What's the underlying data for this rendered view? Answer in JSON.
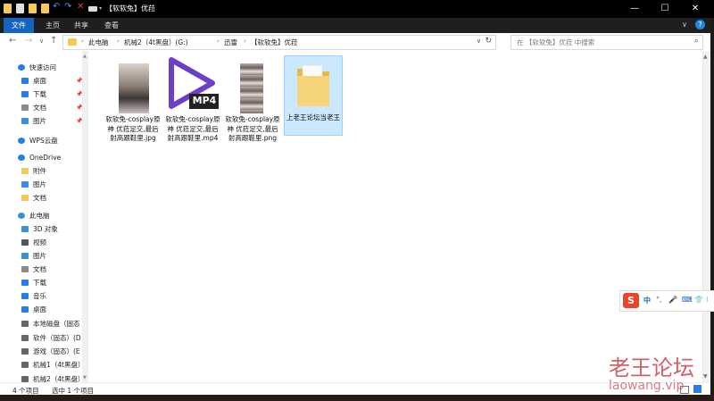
{
  "window": {
    "title": "【软软兔】优菈",
    "minimize_glyph": "—",
    "maximize_glyph": "☐",
    "close_glyph": "✕"
  },
  "ribbon": {
    "tabs": [
      "文件",
      "主页",
      "共享",
      "查看"
    ],
    "collapse_glyph": "∨",
    "help_glyph": "?"
  },
  "navigation": {
    "back": "←",
    "forward": "→",
    "recent": "∨",
    "up": "↑"
  },
  "address": {
    "crumbs": [
      "此电脑",
      "机械2（4t黑盘）(G:)",
      "迅雷",
      "【软软兔】优菈"
    ],
    "separator": "›",
    "dropdown": "∨",
    "refresh": "↻"
  },
  "search": {
    "placeholder": "在 【软软兔】优菈 中搜索",
    "icon": "⌕"
  },
  "sidebar": {
    "items": [
      {
        "label": "快速访问",
        "icon": "star-icon",
        "color": "#2b7ce9",
        "pinned": false
      },
      {
        "label": "桌面",
        "icon": "desktop-icon",
        "color": "#2b7ce9",
        "pinned": true
      },
      {
        "label": "下载",
        "icon": "download-icon",
        "color": "#2b7ce9",
        "pinned": true
      },
      {
        "label": "文档",
        "icon": "documents-icon",
        "color": "#8a8a8a",
        "pinned": true
      },
      {
        "label": "图片",
        "icon": "pictures-icon",
        "color": "#3a8fd9",
        "pinned": true
      },
      {
        "label": "WPS云盘",
        "icon": "cloud-icon",
        "color": "#2b7ce9",
        "pinned": false
      },
      {
        "label": "OneDrive",
        "icon": "onedrive-icon",
        "color": "#2b7ce9",
        "pinned": false
      },
      {
        "label": "附件",
        "icon": "folder-icon",
        "color": "#f3c95a",
        "pinned": false
      },
      {
        "label": "图片",
        "icon": "pictures-icon",
        "color": "#3a8fd9",
        "pinned": false
      },
      {
        "label": "文档",
        "icon": "folder-icon",
        "color": "#f3c95a",
        "pinned": false
      },
      {
        "label": "此电脑",
        "icon": "computer-icon",
        "color": "#3a8fd9",
        "pinned": false
      },
      {
        "label": "3D 对象",
        "icon": "3d-objects-icon",
        "color": "#3a8fd9",
        "pinned": false
      },
      {
        "label": "视频",
        "icon": "video-icon",
        "color": "#555555",
        "pinned": false
      },
      {
        "label": "图片",
        "icon": "pictures-icon",
        "color": "#3a8fd9",
        "pinned": false
      },
      {
        "label": "文档",
        "icon": "documents-icon",
        "color": "#8a8a8a",
        "pinned": false
      },
      {
        "label": "下载",
        "icon": "download-icon",
        "color": "#2b7ce9",
        "pinned": false
      },
      {
        "label": "音乐",
        "icon": "music-icon",
        "color": "#2b7ce9",
        "pinned": false
      },
      {
        "label": "桌面",
        "icon": "desktop-icon",
        "color": "#2b7ce9",
        "pinned": false
      },
      {
        "label": "本地磁盘（固态",
        "icon": "drive-icon",
        "color": "#666666",
        "pinned": false
      },
      {
        "label": "软件（固态）(D",
        "icon": "drive-icon",
        "color": "#666666",
        "pinned": false
      },
      {
        "label": "游戏（固态）(E",
        "icon": "drive-icon",
        "color": "#666666",
        "pinned": false
      },
      {
        "label": "机械1（4t黑盘）",
        "icon": "drive-icon",
        "color": "#666666",
        "pinned": false
      },
      {
        "label": "机械2（4t黑盘）",
        "icon": "drive-icon",
        "color": "#666666",
        "pinned": false
      }
    ],
    "pin_glyph": "📌",
    "scroll_up": "▲",
    "scroll_down": "▼"
  },
  "files": [
    {
      "name": "软软兔-cosplay原神 优菈足交,最后射高跟鞋里.jpg",
      "icon": "image-thumbnail-icon",
      "selected": false
    },
    {
      "name": "软软兔-cosplay原神 优菈足交,最后射高跟鞋里.mp4",
      "icon": "mp4-video-icon",
      "selected": false
    },
    {
      "name": "软软兔-cosplay原神 优菈足交,最后射高跟鞋里.png",
      "icon": "image-thumbnail-icon",
      "selected": false
    },
    {
      "name": "上老王论坛当老王",
      "icon": "folder-icon",
      "selected": true
    }
  ],
  "mp4_badge": "MP4",
  "scroll": {
    "up": "▲",
    "down": "▼"
  },
  "status": {
    "count": "4 个项目",
    "selection": "选中 1 个项目"
  },
  "ime": {
    "logo": "S",
    "items": [
      "中",
      "°,",
      "🎤",
      "⌨",
      "👕",
      "⁝"
    ]
  },
  "watermark": {
    "line1": "老王论坛",
    "line2": "laowang.vip"
  },
  "colors": {
    "accent": "#1565c0",
    "selection": "#cce8ff",
    "folder": "#f3c95a",
    "mp4_purple": "#6b3fc8"
  }
}
